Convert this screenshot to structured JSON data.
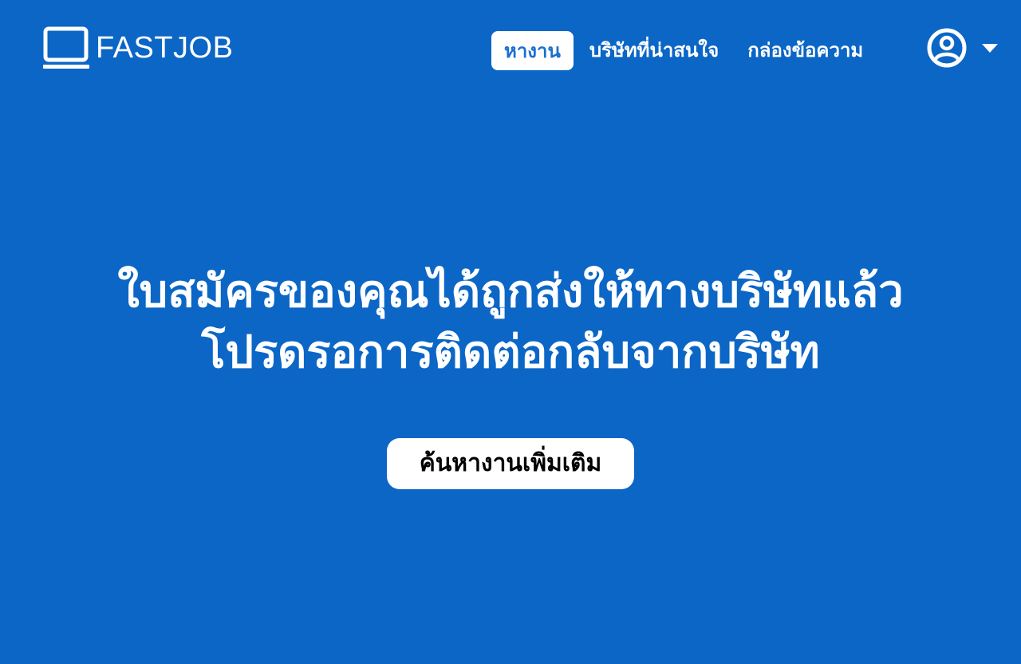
{
  "brand": {
    "name": "FASTJOB",
    "icon": "laptop-icon"
  },
  "nav": {
    "items": [
      {
        "label": "หางาน",
        "active": true
      },
      {
        "label": "บริษัทที่น่าสนใจ",
        "active": false
      },
      {
        "label": "กล่องข้อความ",
        "active": false
      }
    ]
  },
  "account": {
    "icon": "user-circle-icon",
    "dropdown_icon": "caret-down-icon"
  },
  "message": {
    "line1": "ใบสมัครของคุณได้ถูกส่งให้ทางบริษัทแล้ว",
    "line2": "โปรดรอการติดต่อกลับจากบริษัท"
  },
  "cta": {
    "label": "ค้นหางานเพิ่มเติม"
  },
  "colors": {
    "background": "#0b66c6",
    "active_nav_text": "#1a6fd0",
    "surface": "#ffffff"
  }
}
